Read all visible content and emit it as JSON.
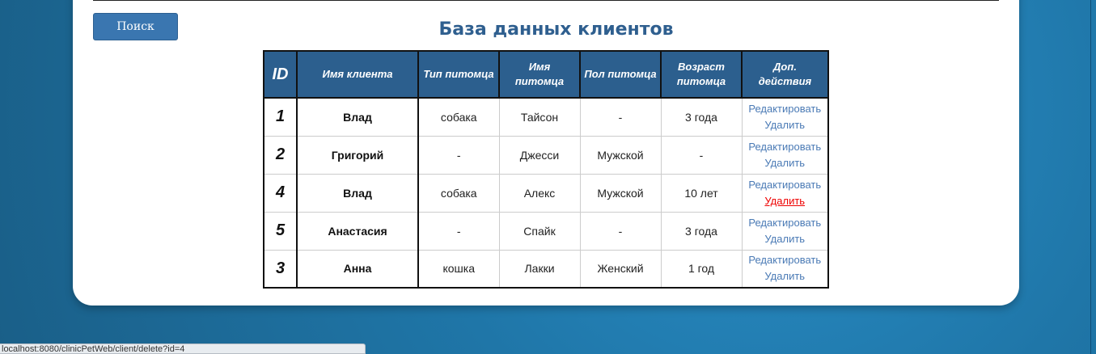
{
  "header": {
    "search_label": "Поиск",
    "title": "База данных клиентов"
  },
  "table": {
    "columns": [
      "ID",
      "Имя клиента",
      "Тип питомца",
      "Имя питомца",
      "Пол питомца",
      "Возраст питомца",
      "Доп. действия"
    ],
    "rows": [
      {
        "id": "1",
        "client": "Влад",
        "pet_type": "собака",
        "pet_name": "Тайсон",
        "pet_sex": "-",
        "pet_age": "3 года",
        "edit": "Редактировать",
        "delete": "Удалить"
      },
      {
        "id": "2",
        "client": "Григорий",
        "pet_type": "-",
        "pet_name": "Джесси",
        "pet_sex": "Мужской",
        "pet_age": "-",
        "edit": "Редактировать",
        "delete": "Удалить"
      },
      {
        "id": "4",
        "client": "Влад",
        "pet_type": "собака",
        "pet_name": "Алекс",
        "pet_sex": "Мужской",
        "pet_age": "10 лет",
        "edit": "Редактировать",
        "delete": "Удалить"
      },
      {
        "id": "5",
        "client": "Анастасия",
        "pet_type": "-",
        "pet_name": "Спайк",
        "pet_sex": "-",
        "pet_age": "3 года",
        "edit": "Редактировать",
        "delete": "Удалить"
      },
      {
        "id": "3",
        "client": "Анна",
        "pet_type": "кошка",
        "pet_name": "Лакки",
        "pet_sex": "Женский",
        "pet_age": "1 год",
        "edit": "Редактировать",
        "delete": "Удалить"
      }
    ]
  },
  "status_bar": {
    "url": "localhost:8080/clinicPetWeb/client/delete?id=4"
  },
  "colors": {
    "header_bg": "#2c5f8e",
    "link": "#4a7ab5",
    "link_hover": "#e00000",
    "title": "#2f5f8f"
  }
}
